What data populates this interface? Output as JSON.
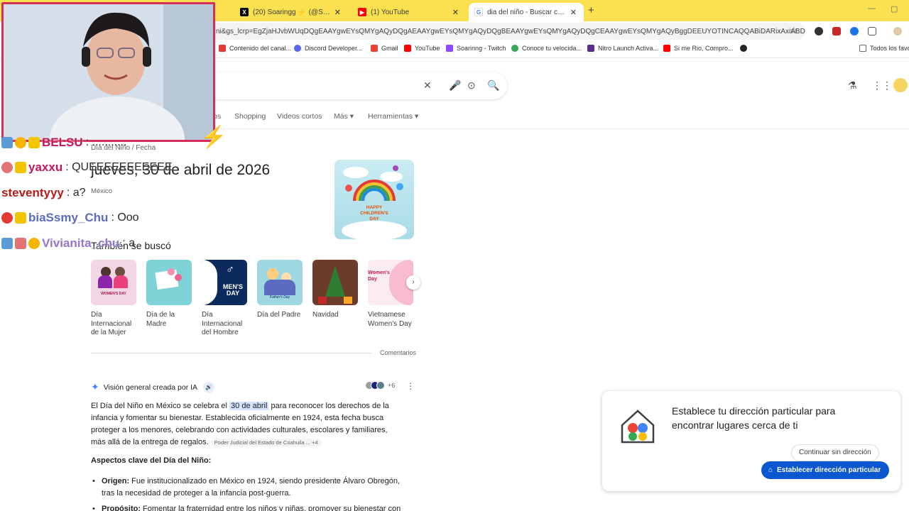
{
  "browser": {
    "tabs": [
      {
        "title": "(20) Soaringg ⚡ (@Soaringch",
        "icon": "x-icon"
      },
      {
        "title": "(1) YouTube",
        "icon": "youtube-icon"
      },
      {
        "title": "dia del niño - Buscar con Goog",
        "icon": "google-icon"
      }
    ],
    "new_tab": "+",
    "url": "ni&gs_lcrp=EgZjaHJvbWUqDQgEAAYgwEYsQMYgAQyDQgAEAAYgwEYsQMYgAQyDQgBEAAYgwEYsQMYgAQyDQgCEAAYgwEYsQMYgAQyBggDEEUYOTINCAQQABiDARixAxiABDINCAU...",
    "bookmarks": [
      {
        "label": "Contenido del canal...",
        "color": "#e53935"
      },
      {
        "label": "Discord Developer...",
        "color": "#5865f2"
      },
      {
        "label": "Gmail",
        "color": "#ea4335"
      },
      {
        "label": "YouTube",
        "color": "#ff0000"
      },
      {
        "label": "Soarinng - Twitch",
        "color": "#9146ff"
      },
      {
        "label": "Conoce tu velocida...",
        "color": "#34a853"
      },
      {
        "label": "Nitro Launch Activa...",
        "color": "#5c2d91"
      },
      {
        "label": "Si me Rio, Compro...",
        "color": "#ff0000"
      }
    ],
    "all_bookmarks": "Todos los favo"
  },
  "search": {
    "tabs": [
      "os",
      "Shopping",
      "Videos cortos",
      "Más ▾",
      "Herramientas ▾"
    ]
  },
  "result": {
    "breadcrumb": "Día del Niño / Fecha",
    "date": "jueves, 30 de abril de 2026",
    "country": "México",
    "also_searched_title": "También se buscó",
    "related": [
      {
        "label": "Día Internacional de la Mujer",
        "thumb_text": "WOMEN'S DAY"
      },
      {
        "label": "Día de la Madre",
        "thumb_text": ""
      },
      {
        "label": "Día Internacional del Hombre",
        "thumb_text": "MEN'S DAY"
      },
      {
        "label": "Día del Padre",
        "thumb_text": "Father's Day"
      },
      {
        "label": "Navidad",
        "thumb_text": ""
      },
      {
        "label": "Vietnamese Women's Day",
        "thumb_text": "Women's Day"
      }
    ],
    "hero_text": "HAPPY CHILDREN'S DAY",
    "feedback": "Comentarios"
  },
  "ai_overview": {
    "title": "Visión general creada por IA",
    "sources_count": "+6",
    "para_1": "El Día del Niño en México se celebra el ",
    "para_highlight": "30 de abril",
    "para_2": " para reconocer los derechos de la infancia y fomentar su bienestar. Establecida oficialmente en 1924, esta fecha busca proteger a los menores, celebrando con actividades culturales, escolares y familiares, más allá de la entrega de regalos.",
    "source_chip": "Poder Judicial del Estado de Coahuila ... +4",
    "subtitle": "Aspectos clave del Día del Niño:",
    "bullet_1_bold": "Origen:",
    "bullet_1_text": " Fue institucionalizado en México en 1924, siendo presidente Álvaro Obregón, tras la necesidad de proteger a la infancia post-guerra.",
    "bullet_2_bold": "Propósito:",
    "bullet_2_text": " Fomentar la fraternidad entre los niños y niñas, promover su bienestar con"
  },
  "location_card": {
    "title": "Establece tu dirección particular para encontrar lugares cerca de ti",
    "skip": "Continuar sin dirección",
    "set": "Establecer dirección particular"
  },
  "chat": [
    {
      "user": "BELSU",
      "message": ": ...........",
      "color": "#c2185b"
    },
    {
      "user": "yaxxu",
      "message": ": QUEEEEEEEEEEE",
      "color": "#c2185b"
    },
    {
      "user": "steventyyy",
      "message": ": a?",
      "color": "#b71c1c"
    },
    {
      "user": "biaSsmy_Chu",
      "message": ": Ooo",
      "color": "#5c6bc0"
    },
    {
      "user": "Vivianita_chu",
      "message": ": a",
      "color": "#9575cd"
    }
  ],
  "colors": {
    "tabstrip": "#fbe04f",
    "accent": "#0b57d0",
    "cam_border": "#d32f5a"
  }
}
